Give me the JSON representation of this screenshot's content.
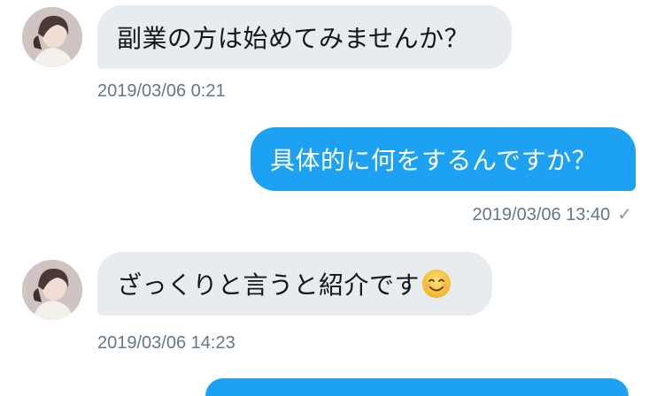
{
  "conversation": {
    "messages": [
      {
        "direction": "incoming",
        "text": "副業の方は始めてみませんか？",
        "timestamp": "2019/03/06 0:21"
      },
      {
        "direction": "outgoing",
        "text": "具体的に何をするんですか？",
        "timestamp": "2019/03/06 13:40",
        "status_icon": "checkmark-icon"
      },
      {
        "direction": "incoming",
        "text": "ざっくりと言うと紹介です",
        "emoji": "smiling-face-emoji",
        "timestamp": "2019/03/06 14:23"
      }
    ]
  },
  "colors": {
    "incoming_bubble": "#e6ecf0",
    "outgoing_bubble": "#1da1f2",
    "timestamp_text": "#657786"
  }
}
